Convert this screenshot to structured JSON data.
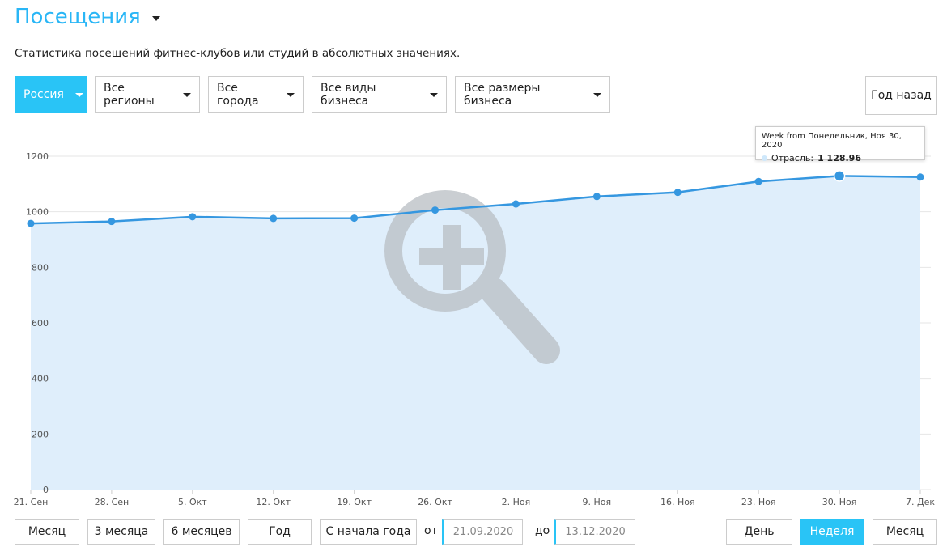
{
  "header": {
    "title": "Посещения"
  },
  "subtitle": "Статистика посещений фитнес-клубов или студий в абсолютных значениях.",
  "filters": {
    "country": "Россия",
    "region": "Все регионы",
    "city": "Все города",
    "business_type": "Все виды бизнеса",
    "business_size": "Все размеры бизнеса",
    "year_back": "Год назад"
  },
  "tooltip": {
    "title": "Week from Понедельник, Ноя 30, 2020",
    "series_label": "Отрасль:",
    "value": "1 128.96"
  },
  "chart_data": {
    "type": "area",
    "categories": [
      "21. Сен",
      "28. Сен",
      "5. Окт",
      "12. Окт",
      "19. Окт",
      "26. Окт",
      "2. Ноя",
      "9. Ноя",
      "16. Ноя",
      "23. Ноя",
      "30. Ноя",
      "7. Дек"
    ],
    "series": [
      {
        "values": [
          958,
          965,
          982,
          976,
          977,
          1006,
          1028,
          1055,
          1070,
          1109,
          1128.96,
          1125
        ]
      }
    ],
    "yticks": [
      0,
      200,
      400,
      600,
      800,
      1000,
      1200
    ],
    "ylim": [
      0,
      1200
    ],
    "grid": true,
    "highlight_index": 10,
    "colors": {
      "line": "#3597e0",
      "fill": "#dfeefb",
      "accent": "#29c4f6"
    }
  },
  "ranges": {
    "month": "Месяц",
    "three_months": "3 месяца",
    "six_months": "6 месяцев",
    "year": "Год",
    "ytd": "С начала года"
  },
  "dates": {
    "from_label": "от",
    "from": "21.09.2020",
    "to_label": "до",
    "to": "13.12.2020"
  },
  "granularity": {
    "day": "День",
    "week": "Неделя",
    "month": "Месяц"
  }
}
